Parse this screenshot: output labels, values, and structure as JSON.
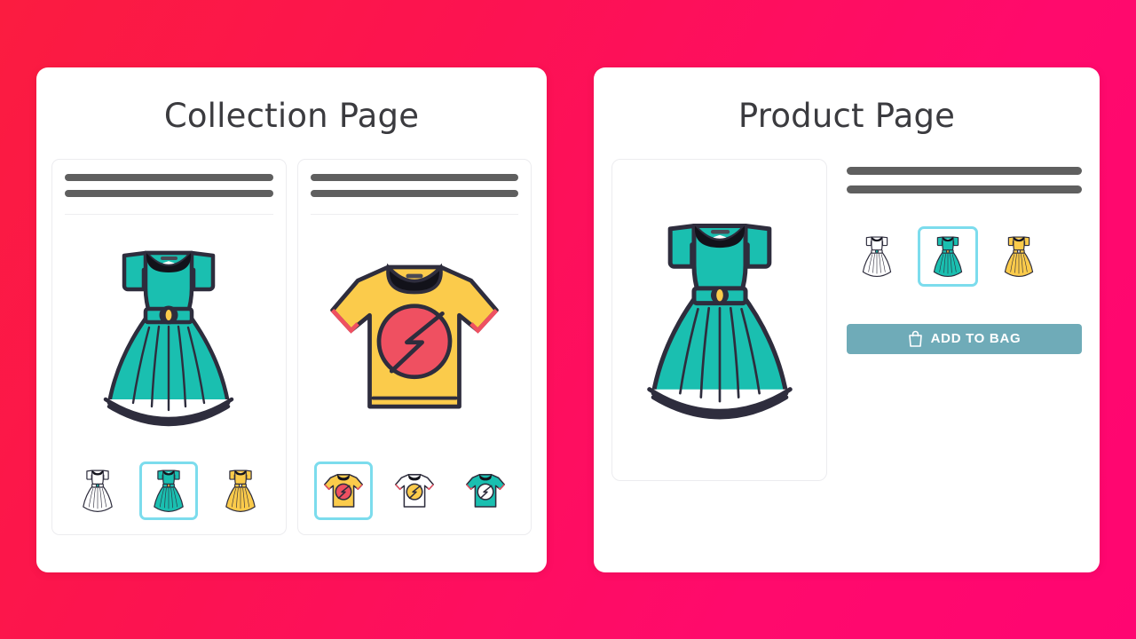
{
  "background": {
    "gradient_from": "#FB1C40",
    "gradient_to": "#FF0571"
  },
  "accent": {
    "selected_border": "#7CDCED",
    "skeleton_bar": "#5F5F5F",
    "button_bg": "#6FABB8",
    "teal": "#1ABFB0",
    "yellow": "#FBCB4B",
    "white_garment": "#FFFFFF",
    "outline": "#2E2D3D",
    "tee_red": "#EF5061"
  },
  "collection_panel": {
    "title": "Collection Page",
    "cards": [
      {
        "hero": "dress-teal",
        "skeleton_lines": 2,
        "thumbnails": [
          {
            "icon": "dress-white-icon",
            "variant": "white",
            "selected": false
          },
          {
            "icon": "dress-teal-icon",
            "variant": "teal",
            "selected": true
          },
          {
            "icon": "dress-yellow-icon",
            "variant": "yellow",
            "selected": false
          }
        ]
      },
      {
        "hero": "tshirt-yellow",
        "skeleton_lines": 2,
        "thumbnails": [
          {
            "icon": "tshirt-yellow-icon",
            "variant": "yellow",
            "selected": true
          },
          {
            "icon": "tshirt-white-icon",
            "variant": "white",
            "selected": false
          },
          {
            "icon": "tshirt-teal-icon",
            "variant": "teal",
            "selected": false
          }
        ]
      }
    ]
  },
  "product_panel": {
    "title": "Product Page",
    "gallery": {
      "hero": "dress-teal"
    },
    "skeleton_lines": 2,
    "thumbnails": [
      {
        "icon": "dress-white-icon",
        "variant": "white",
        "selected": false
      },
      {
        "icon": "dress-teal-icon",
        "variant": "teal",
        "selected": true
      },
      {
        "icon": "dress-yellow-icon",
        "variant": "yellow",
        "selected": false
      }
    ],
    "add_to_bag": {
      "label": "ADD TO BAG",
      "icon": "shopping-bag-icon"
    }
  }
}
